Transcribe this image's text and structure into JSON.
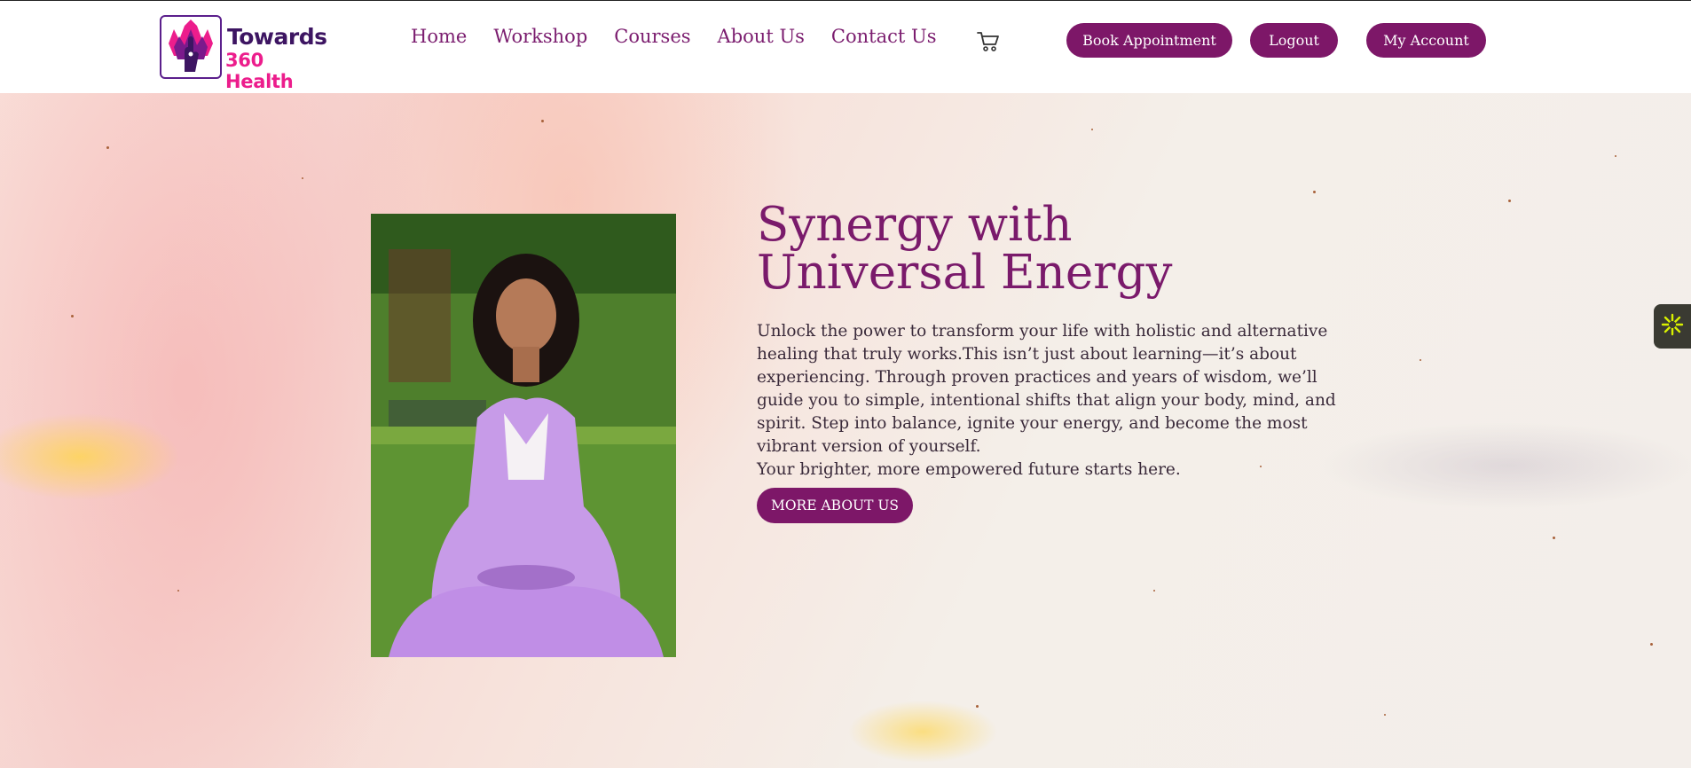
{
  "header": {
    "logo": {
      "line1": "Towards",
      "line2": "360 Health"
    },
    "nav": [
      "Home",
      "Workshop",
      "Courses",
      "About Us",
      "Contact Us"
    ],
    "cart_icon": "cart-icon",
    "buttons": {
      "book": "Book Appointment",
      "logout": "Logout",
      "account": "My Account"
    }
  },
  "hero": {
    "title": "Synergy with Universal Energy",
    "paragraph1": "Unlock the power to transform your life with holistic and alternative healing that truly works.This isn’t just about learning—it’s about experiencing. Through proven practices and years of wisdom, we’ll guide you to simple, intentional shifts that align your body, mind, and spirit. Step into balance, ignite your energy, and become the most vibrant version of yourself.",
    "paragraph2": "Your brighter, more empowered future starts here.",
    "button": "MORE ABOUT US",
    "image_icon": "meditation-photo"
  },
  "side_widget": {
    "icon": "accessibility-icon"
  },
  "colors": {
    "brand": "#7d1768",
    "brand_dark": "#3d1562",
    "accent_pink": "#ec1d8c",
    "text": "#3a2a3a"
  }
}
